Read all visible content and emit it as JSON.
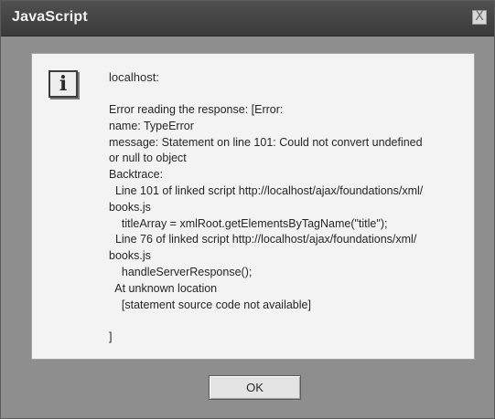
{
  "dialog": {
    "title": "JavaScript",
    "close_label": "X",
    "icon": "info-icon",
    "icon_glyph": "i",
    "host": "localhost:",
    "message_lines": [
      "Error reading the response: [Error:",
      "name: TypeError",
      "message: Statement on line 101: Could not convert undefined",
      "or null to object",
      "Backtrace:",
      "  Line 101 of linked script http://localhost/ajax/foundations/xml/",
      "books.js",
      "    titleArray = xmlRoot.getElementsByTagName(\"title\");",
      "  Line 76 of linked script http://localhost/ajax/foundations/xml/",
      "books.js",
      "    handleServerResponse();",
      "  At unknown location",
      "    [statement source code not available]",
      "",
      "]"
    ],
    "ok_label": "OK"
  }
}
